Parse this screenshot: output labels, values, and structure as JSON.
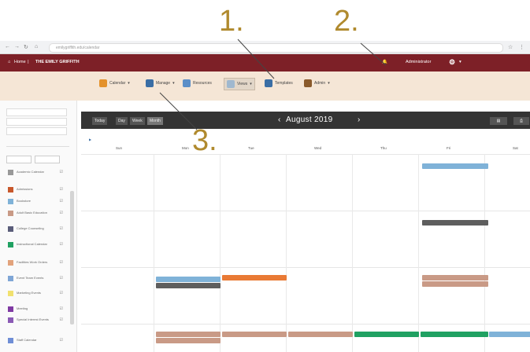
{
  "annotations": {
    "a1": "1.",
    "a2": "2.",
    "a3": "3."
  },
  "header": {
    "title": "THE EMILY GRIFFITH",
    "user": "Administrator"
  },
  "toolbar": {
    "items": [
      {
        "label": "Calendar",
        "color": "#e4922c"
      },
      {
        "label": "Manage",
        "color": "#3a6ea5"
      },
      {
        "label": "Resources",
        "color": "#5c8fc8"
      },
      {
        "label": "Views",
        "color": "#9fb8cf"
      },
      {
        "label": "Templates",
        "color": "#3a6ea5"
      },
      {
        "label": "Admin",
        "color": "#8a5a2b"
      }
    ]
  },
  "calendar": {
    "month_label": "August 2019",
    "view_buttons": [
      "Today",
      "Day",
      "Week",
      "Month"
    ],
    "day_names": [
      "Sun",
      "Mon",
      "Tue",
      "Wed",
      "Thu",
      "Fri",
      "Sat"
    ]
  },
  "sidebar": {
    "calendars": [
      {
        "label": "Academic Calendar",
        "color": "#999999"
      },
      {
        "label": "Admissions",
        "color": "#c8582c"
      },
      {
        "label": "Bookstore",
        "color": "#7fb2d8"
      },
      {
        "label": "Adult Basic Education",
        "color": "#c99a86"
      },
      {
        "label": "College Counseling",
        "color": "#5a5d7a"
      },
      {
        "label": "Instructional Calendar",
        "color": "#20a162"
      },
      {
        "label": "Facilities Work Orders",
        "color": "#e2a37c"
      },
      {
        "label": "Event Team Events",
        "color": "#7fa6d6"
      },
      {
        "label": "Marketing Events",
        "color": "#f1e16f"
      },
      {
        "label": "Meeting",
        "color": "#7f3aa3"
      },
      {
        "label": "Special Interest Events",
        "color": "#8a5ab5"
      },
      {
        "label": "Staff Calendar",
        "color": "#6f8ed6"
      }
    ]
  },
  "colors": {
    "brand": "#7d2027",
    "toolbar_bg": "#f5e6d6",
    "annotation": "#b08a2e"
  }
}
